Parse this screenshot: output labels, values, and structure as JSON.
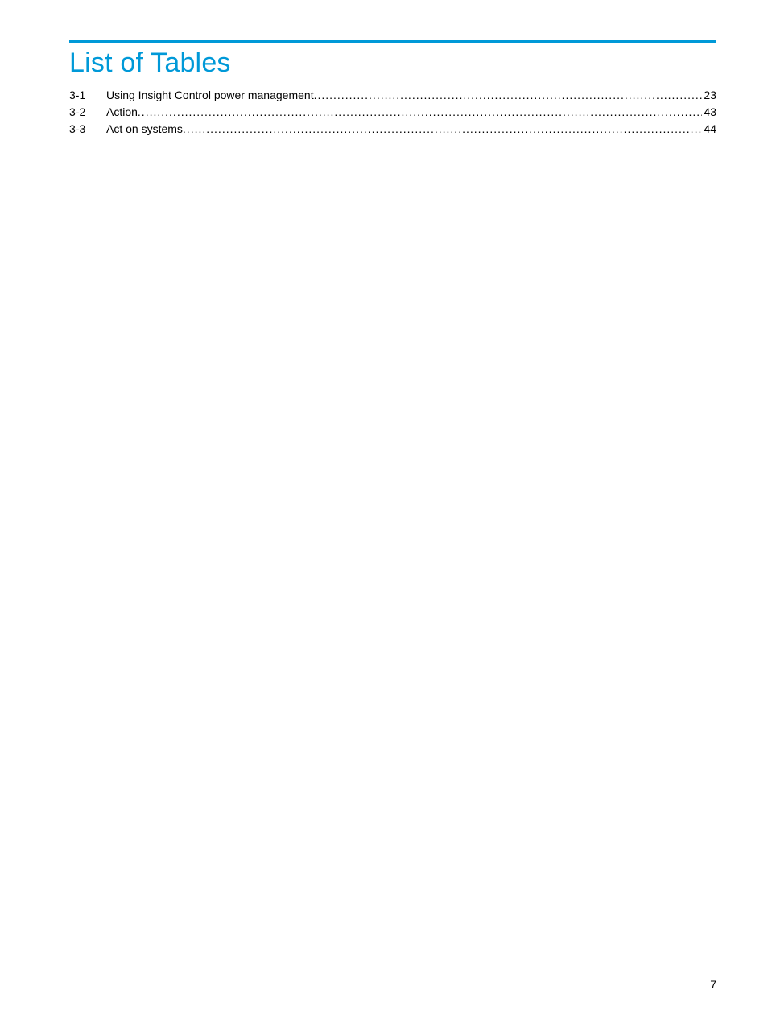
{
  "heading": "List of Tables",
  "entries": [
    {
      "num": "3-1",
      "title": "Using Insight Control power management",
      "page": "23"
    },
    {
      "num": "3-2",
      "title": "Action",
      "page": "43"
    },
    {
      "num": "3-3",
      "title": "Act on systems",
      "page": "44"
    }
  ],
  "page_number": "7"
}
